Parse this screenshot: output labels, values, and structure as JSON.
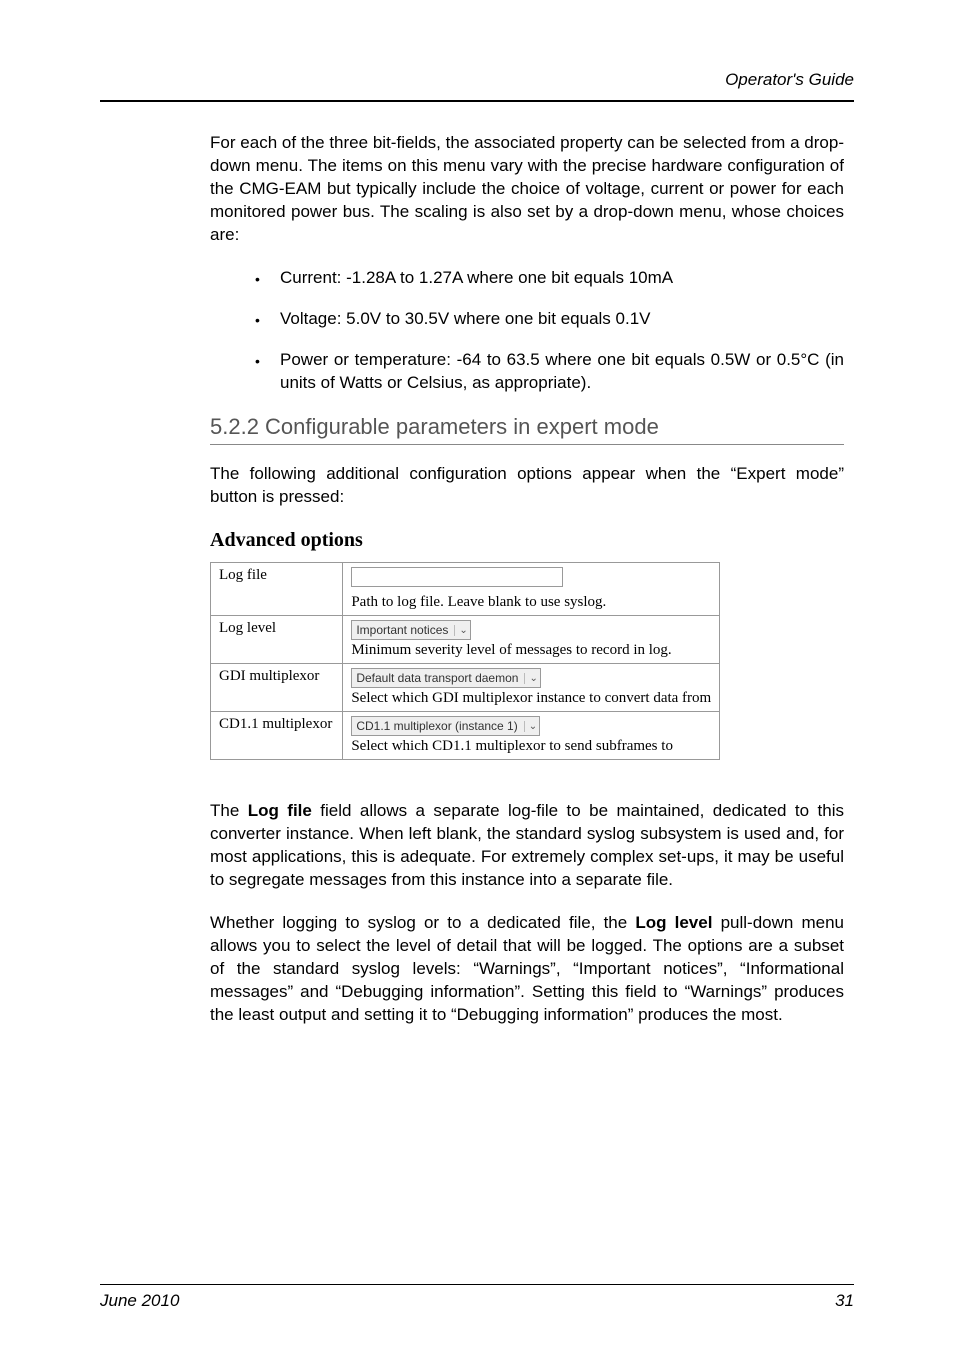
{
  "header": {
    "title": "Operator's Guide"
  },
  "intro": "For each of the three bit-fields, the associated property can be selected from a drop-down menu.  The items on this menu vary with the precise hardware configuration of the CMG-EAM but typically include the choice of voltage, current or power for each monitored power bus.  The scaling is also set by a drop-down menu, whose choices are:",
  "bullets": {
    "b1": "Current: -1.28A to 1.27A where one bit equals 10mA",
    "b2": "Voltage: 5.0V to 30.5V where one bit equals 0.1V",
    "b3": "Power or temperature: -64 to 63.5 where one bit equals 0.5W or 0.5°C (in units of Watts or Celsius, as appropriate)."
  },
  "subheading": "5.2.2 Configurable parameters in expert mode",
  "expert_intro": "The following additional configuration options appear when the “Expert mode” button is pressed:",
  "adv_title": "Advanced options",
  "adv": {
    "rows": [
      {
        "label": "Log file",
        "control_type": "input",
        "value": "",
        "help": "Path to log file. Leave blank to use syslog."
      },
      {
        "label": "Log level",
        "control_type": "select",
        "value": "Important notices",
        "help": "Minimum severity level of messages to record in log."
      },
      {
        "label": "GDI multiplexor",
        "control_type": "select",
        "value": "Default data transport daemon",
        "help": "Select which GDI multiplexor instance to convert data from"
      },
      {
        "label": "CD1.1 multiplexor",
        "control_type": "select",
        "value": "CD1.1 multiplexor (instance 1)",
        "help": "Select which CD1.1 multiplexor to send subframes to"
      }
    ]
  },
  "logfile_para_pre": "The ",
  "logfile_bold": "Log file",
  "logfile_para_post": " field allows a separate log-file to be maintained, dedicated to this converter instance.  When left blank, the standard syslog subsystem is used and, for most applications, this is adequate.  For extremely complex set-ups, it may be useful to segregate messages from this instance into a separate file.",
  "loglevel_para_pre": "Whether logging to syslog or to a dedicated file, the ",
  "loglevel_bold": "Log level",
  "loglevel_para_post": " pull-down menu allows you to select the level of detail that will be logged.  The options are a subset of the standard syslog levels: “Warnings”, “Important notices”, “Informational messages” and “Debugging information”.  Setting this field to “Warnings” produces the least output and setting it to “Debugging information” produces the most.",
  "footer": {
    "date": "June 2010",
    "page": "31"
  }
}
